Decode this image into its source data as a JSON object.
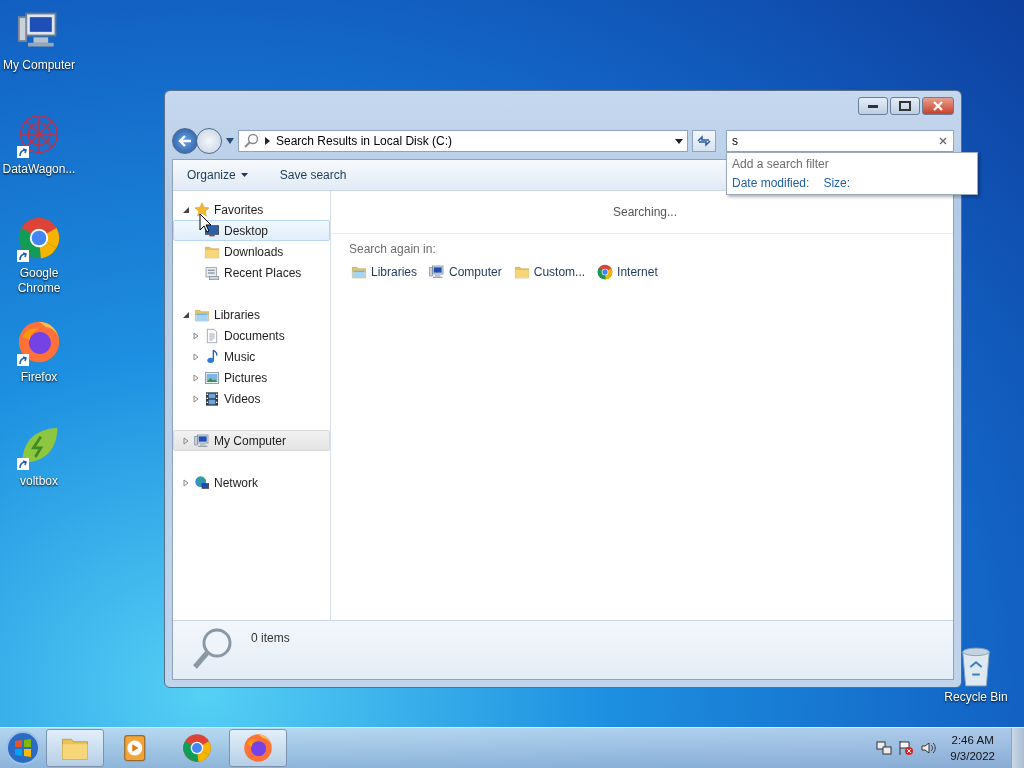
{
  "desktop_icons": [
    {
      "label": "My Computer",
      "kind": "computer",
      "shortcut": false
    },
    {
      "label": "DataWagon...",
      "kind": "network-web",
      "shortcut": true
    },
    {
      "label": "Google Chrome",
      "kind": "chrome",
      "shortcut": true
    },
    {
      "label": "Firefox",
      "kind": "firefox",
      "shortcut": true
    },
    {
      "label": "voltbox",
      "kind": "leaf",
      "shortcut": true
    }
  ],
  "recycle_bin": {
    "label": "Recycle Bin"
  },
  "window": {
    "address": "Search Results in Local Disk (C:)",
    "search": {
      "value": "s"
    },
    "toolbar": [
      {
        "label": "Organize",
        "dropdown": true
      },
      {
        "label": "Save search",
        "dropdown": false
      }
    ],
    "search_filter": {
      "heading": "Add a search filter",
      "filters": [
        "Date modified:",
        "Size:"
      ]
    },
    "nav": [
      {
        "label": "Favorites",
        "kind": "star",
        "expanded": true,
        "selected": false,
        "hovered": false,
        "children": [
          {
            "label": "Desktop",
            "kind": "monitor",
            "selected": false,
            "hovered": true
          },
          {
            "label": "Downloads",
            "kind": "folder",
            "selected": false,
            "hovered": false
          },
          {
            "label": "Recent Places",
            "kind": "recent",
            "selected": false,
            "hovered": false
          }
        ]
      },
      {
        "label": "Libraries",
        "kind": "library",
        "expanded": true,
        "selected": false,
        "hovered": false,
        "children": [
          {
            "label": "Documents",
            "kind": "document",
            "expanded": false,
            "selected": false,
            "hovered": false
          },
          {
            "label": "Music",
            "kind": "music",
            "expanded": false,
            "selected": false,
            "hovered": false
          },
          {
            "label": "Pictures",
            "kind": "picture",
            "expanded": false,
            "selected": false,
            "hovered": false
          },
          {
            "label": "Videos",
            "kind": "film",
            "expanded": false,
            "selected": false,
            "hovered": false
          }
        ]
      },
      {
        "label": "My Computer",
        "kind": "computer",
        "expanded": false,
        "selected": true,
        "hovered": false
      },
      {
        "label": "Network",
        "kind": "globe",
        "expanded": false,
        "selected": false,
        "hovered": false
      }
    ],
    "status": "Searching...",
    "search_again": {
      "label": "Search again in:",
      "locations": [
        {
          "label": "Libraries",
          "kind": "library"
        },
        {
          "label": "Computer",
          "kind": "computer"
        },
        {
          "label": "Custom...",
          "kind": "folder"
        },
        {
          "label": "Internet",
          "kind": "chrome"
        }
      ]
    },
    "details": {
      "count": "0 items"
    }
  },
  "taskbar": {
    "apps": [
      {
        "kind": "explorer",
        "active": true
      },
      {
        "kind": "media",
        "active": false
      },
      {
        "kind": "chrome",
        "active": false
      },
      {
        "kind": "firefox",
        "active": true
      }
    ],
    "clock": {
      "time": "2:46 AM",
      "date": "9/3/2022"
    }
  }
}
